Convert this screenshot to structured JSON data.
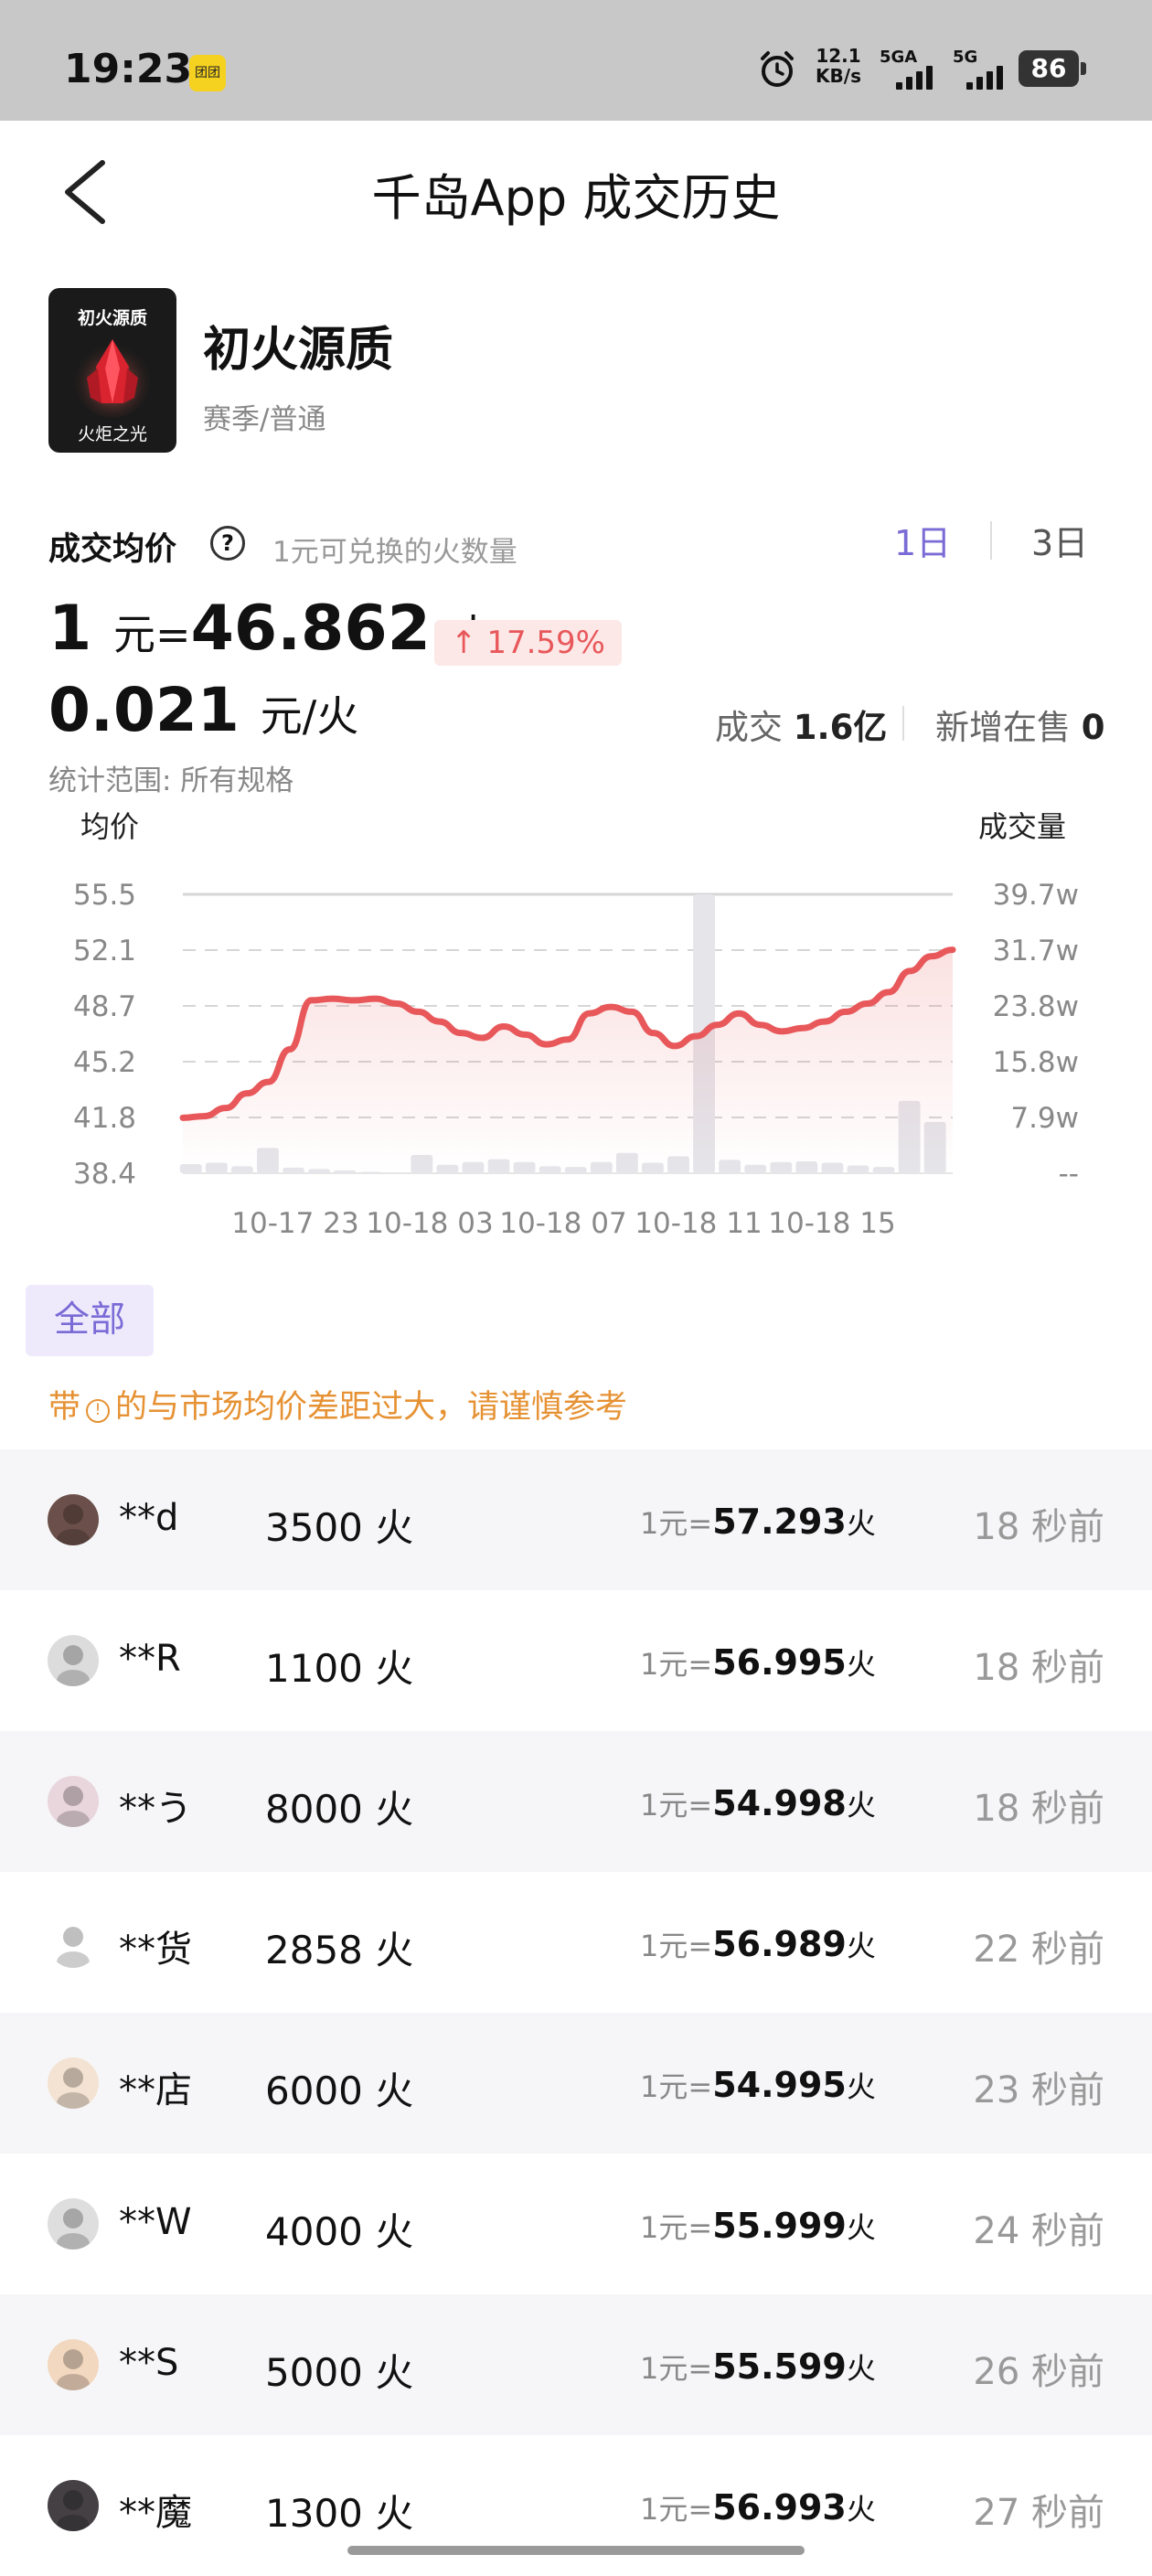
{
  "status_bar": {
    "time": "19:23",
    "mini_app_label": "团团",
    "net_speed_value": "12.1",
    "net_speed_unit": "KB/s",
    "signal1_label": "5GA",
    "signal2_label": "5G",
    "battery": "86",
    "icons": [
      "alarm-icon",
      "signal-icon",
      "battery-icon"
    ]
  },
  "nav": {
    "back_icon": "chevron-left-icon",
    "title": "千岛App 成交历史"
  },
  "product": {
    "thumb_top_text": "初火源质",
    "thumb_bottom_text": "火炬之光",
    "name": "初火源质",
    "subtitle": "赛季/普通"
  },
  "price": {
    "title": "成交均价",
    "help_icon": "question-circle-icon",
    "description": "1元可兑换的火数量",
    "tabs": [
      "1日",
      "3日"
    ],
    "active_tab": "1日",
    "rate_prefix": "1",
    "rate_unit": "元=",
    "rate_value": "46.862",
    "rate_suffix": "火",
    "change": "17.59%",
    "change_arrow": "↑",
    "per_value": "0.021",
    "per_unit": "元/火",
    "volume_label": "成交",
    "volume_value": "1.6亿",
    "new_label": "新增在售",
    "new_value": "0",
    "scope": "统计范围: 所有规格"
  },
  "colors": {
    "accent": "#7a6bd6",
    "line": "#e8585a",
    "warning": "#e69234",
    "up": "#e8585a"
  },
  "chart_data": {
    "type": "line",
    "ylabel_left": "均价",
    "ylabel_right": "成交量",
    "yticks_left": [
      "55.5",
      "52.1",
      "48.7",
      "45.2",
      "41.8",
      "38.4"
    ],
    "yticks_right": [
      "39.7w",
      "31.7w",
      "23.8w",
      "15.8w",
      "7.9w",
      "--"
    ],
    "ylim_left": [
      38.4,
      55.5
    ],
    "ylim_right": [
      0,
      39.7
    ],
    "xticks": [
      "10-17 23",
      "10-18 03",
      "10-18 07",
      "10-18 11",
      "10-18 15"
    ],
    "series": [
      {
        "type": "line",
        "values": [
          41.8,
          41.9,
          42.4,
          43.3,
          44.0,
          46.0,
          49.0,
          49.1,
          49.0,
          49.1,
          48.8,
          48.3,
          47.7,
          47.0,
          46.7,
          47.4,
          46.9,
          46.3,
          46.6,
          48.2,
          48.6,
          48.3,
          47.0,
          46.2,
          46.8,
          47.5,
          48.2,
          47.5,
          47.1,
          47.3,
          47.7,
          48.3,
          48.8,
          49.5,
          50.8,
          51.7,
          52.1
        ]
      },
      {
        "type": "bar",
        "values": [
          1.3,
          1.5,
          1.0,
          3.6,
          0.8,
          0.6,
          0.4,
          0.2,
          0.1,
          2.6,
          1.2,
          1.6,
          2.0,
          1.6,
          1.0,
          0.9,
          1.6,
          2.9,
          1.5,
          2.4,
          39.7,
          1.9,
          1.2,
          1.6,
          1.7,
          1.5,
          1.1,
          0.9,
          10.3,
          7.3
        ]
      }
    ]
  },
  "filter": {
    "all_label": "全部",
    "warning_before": "带",
    "warning_icon": "!",
    "warning_after": "的与市场均价差距过大，请谨慎参考"
  },
  "trades": [
    {
      "user": "**d",
      "amount": "3500 火",
      "rate_prefix": "1元=",
      "rate": "57.293",
      "rate_suffix": "火",
      "ago": "18 秒前",
      "avatar_color": "#6b4f4a"
    },
    {
      "user": "**R",
      "amount": "1100 火",
      "rate_prefix": "1元=",
      "rate": "56.995",
      "rate_suffix": "火",
      "ago": "18 秒前",
      "avatar_color": "#dcdcdc"
    },
    {
      "user": "**う",
      "amount": "8000 火",
      "rate_prefix": "1元=",
      "rate": "54.998",
      "rate_suffix": "火",
      "ago": "18 秒前",
      "avatar_color": "#e9d6dc"
    },
    {
      "user": "**货",
      "amount": "2858 火",
      "rate_prefix": "1元=",
      "rate": "56.989",
      "rate_suffix": "火",
      "ago": "22 秒前",
      "avatar_color": "#ffffff"
    },
    {
      "user": "**店",
      "amount": "6000 火",
      "rate_prefix": "1元=",
      "rate": "54.995",
      "rate_suffix": "火",
      "ago": "23 秒前",
      "avatar_color": "#f4e3d2"
    },
    {
      "user": "**W",
      "amount": "4000 火",
      "rate_prefix": "1元=",
      "rate": "55.999",
      "rate_suffix": "火",
      "ago": "24 秒前",
      "avatar_color": "#dedede"
    },
    {
      "user": "**S",
      "amount": "5000 火",
      "rate_prefix": "1元=",
      "rate": "55.599",
      "rate_suffix": "火",
      "ago": "26 秒前",
      "avatar_color": "#f3d8c0"
    },
    {
      "user": "**魔",
      "amount": "1300 火",
      "rate_prefix": "1元=",
      "rate": "56.993",
      "rate_suffix": "火",
      "ago": "27 秒前",
      "avatar_color": "#444044"
    }
  ]
}
